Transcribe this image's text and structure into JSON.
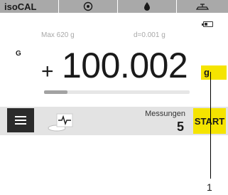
{
  "statusbar": {
    "title": "isoCAL",
    "icons": [
      "level-icon",
      "drop-icon",
      "balance-icon"
    ]
  },
  "info": {
    "max": "Max 620 g",
    "readability": "d=0.001 g"
  },
  "display": {
    "mode": "G",
    "sign": "+",
    "value": "100.002",
    "unit": "g"
  },
  "progress": {
    "fraction": 0.16
  },
  "toolbar": {
    "messungen_label": "Messungen",
    "messungen_count": "5",
    "start_label": "START"
  },
  "callout": {
    "number": "1"
  },
  "colors": {
    "accent": "#f5e400",
    "statusbar": "#a9a9a9",
    "toolbar": "#e3e3e3",
    "menu": "#2b2b2b"
  }
}
